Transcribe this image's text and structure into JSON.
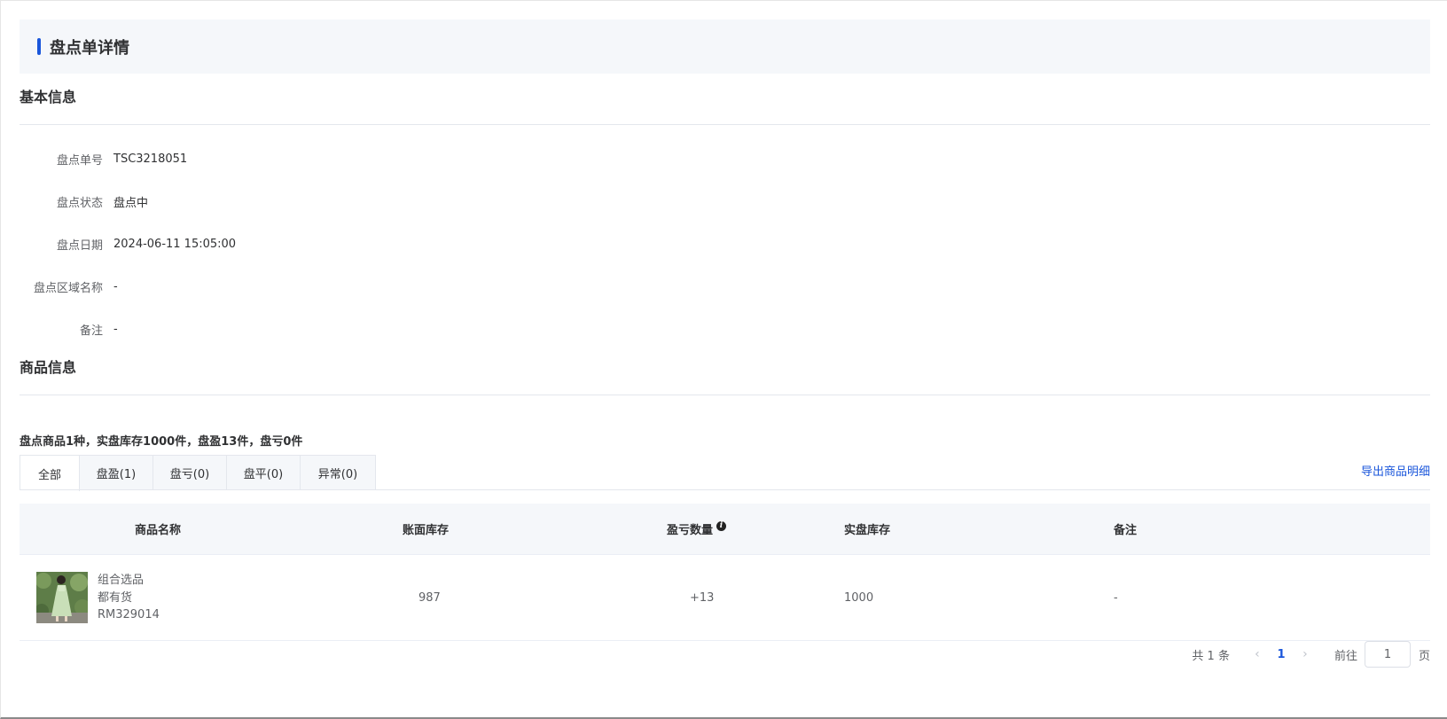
{
  "header": {
    "title": "盘点单详情"
  },
  "basic": {
    "section_title": "基本信息",
    "fields": [
      {
        "label": "盘点单号",
        "value": "TSC3218051"
      },
      {
        "label": "盘点状态",
        "value": "盘点中"
      },
      {
        "label": "盘点日期",
        "value": "2024-06-11 15:05:00"
      },
      {
        "label": "盘点区域名称",
        "value": "-"
      },
      {
        "label": "备注",
        "value": "-"
      }
    ]
  },
  "goods": {
    "section_title": "商品信息",
    "summary": "盘点商品1种，实盘库存1000件，盘盈13件，盘亏0件",
    "tabs": [
      {
        "label": "全部",
        "active": true
      },
      {
        "label": "盘盈(1)",
        "active": false
      },
      {
        "label": "盘亏(0)",
        "active": false
      },
      {
        "label": "盘平(0)",
        "active": false
      },
      {
        "label": "异常(0)",
        "active": false
      }
    ],
    "export_label": "导出商品明细",
    "columns": [
      "商品名称",
      "账面库存",
      "盈亏数量",
      "实盘库存",
      "备注"
    ],
    "info_icon": "i",
    "rows": [
      {
        "name": "组合选品",
        "tag": "都有货",
        "code": "RM329014",
        "book_stock": "987",
        "diff": "+13",
        "actual_stock": "1000",
        "remark": "-"
      }
    ]
  },
  "pagination": {
    "total": "共 1 条",
    "prev": "‹",
    "current": "1",
    "next": "›",
    "goto_label": "前往",
    "goto_value": "1",
    "page_unit": "页"
  }
}
